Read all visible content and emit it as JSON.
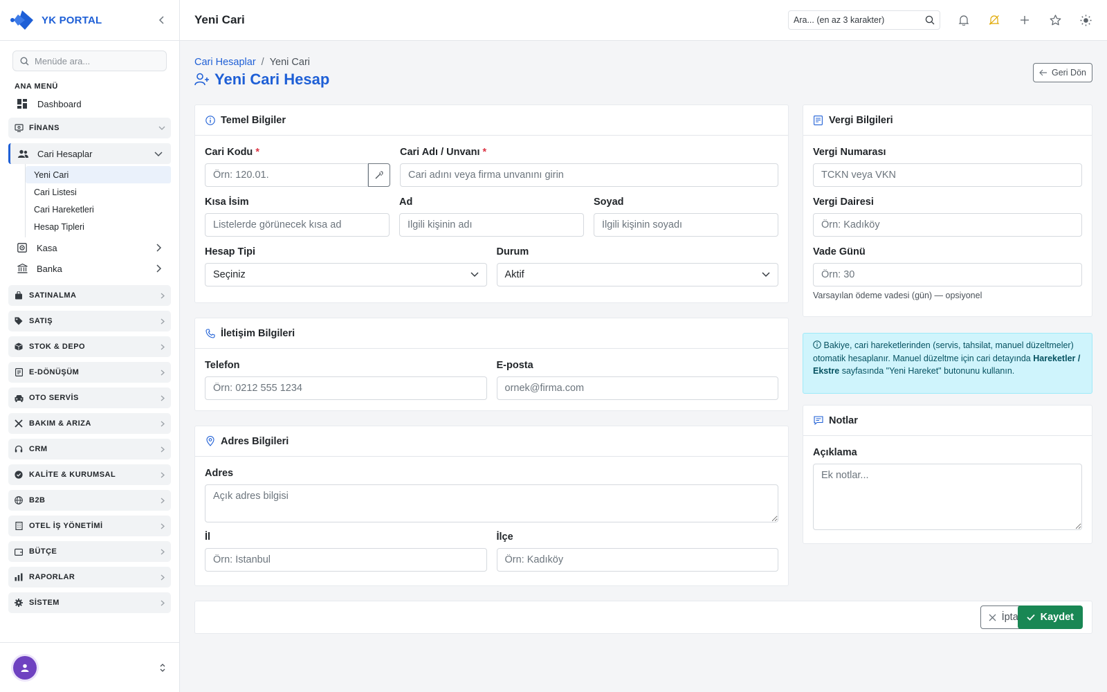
{
  "brand": {
    "name": "YK PORTAL"
  },
  "sidebar": {
    "search_placeholder": "Menüde ara...",
    "section_title": "ANA MENÜ",
    "dashboard_label": "Dashboard",
    "finans_label": "FİNANS",
    "cari_label": "Cari Hesaplar",
    "cari_sub": [
      "Yeni Cari",
      "Cari Listesi",
      "Cari Hareketleri",
      "Hesap Tipleri"
    ],
    "kasa_label": "Kasa",
    "banka_label": "Banka",
    "groups": [
      "SATINALMA",
      "SATIŞ",
      "STOK & DEPO",
      "E-DÖNÜŞÜM",
      "OTO SERVİS",
      "BAKIM & ARIZA",
      "CRM",
      "KALİTE & KURUMSAL",
      "B2B",
      "OTEL İŞ YÖNETİMİ",
      "BÜTÇE",
      "RAPORLAR",
      "SİSTEM"
    ]
  },
  "topbar": {
    "title": "Yeni Cari",
    "search_placeholder": "Ara... (en az 3 karakter)"
  },
  "breadcrumb": {
    "parent": "Cari Hesaplar",
    "separator": "/",
    "current": "Yeni Cari"
  },
  "page": {
    "title": "Yeni Cari Hesap",
    "back_label": "Geri Dön"
  },
  "temel": {
    "title": "Temel Bilgiler",
    "cari_kodu_label": "Cari Kodu",
    "cari_kodu_placeholder": "Örn: 120.01.",
    "cari_adi_label": "Cari Adı / Unvanı",
    "cari_adi_placeholder": "Cari adını veya firma unvanını girin",
    "kisa_isim_label": "Kısa İsim",
    "kisa_isim_placeholder": "Listelerde görünecek kısa ad",
    "ad_label": "Ad",
    "ad_placeholder": "İlgili kişinin adı",
    "soyad_label": "Soyad",
    "soyad_placeholder": "İlgili kişinin soyadı",
    "hesap_tipi_label": "Hesap Tipi",
    "hesap_tipi_value": "Seçiniz",
    "durum_label": "Durum",
    "durum_value": "Aktif",
    "required_mark": "*"
  },
  "iletisim": {
    "title": "İletişim Bilgileri",
    "telefon_label": "Telefon",
    "telefon_placeholder": "Örn: 0212 555 1234",
    "eposta_label": "E-posta",
    "eposta_placeholder": "ornek@firma.com"
  },
  "adres": {
    "title": "Adres Bilgileri",
    "adres_label": "Adres",
    "adres_placeholder": "Açık adres bilgisi",
    "il_label": "İl",
    "il_placeholder": "Örn: İstanbul",
    "ilce_label": "İlçe",
    "ilce_placeholder": "Örn: Kadıköy"
  },
  "vergi": {
    "title": "Vergi Bilgileri",
    "no_label": "Vergi Numarası",
    "no_placeholder": "TCKN veya VKN",
    "daire_label": "Vergi Dairesi",
    "daire_placeholder": "Örn: Kadıköy",
    "vade_label": "Vade Günü",
    "vade_placeholder": "Örn: 30",
    "vade_help": "Varsayılan ödeme vadesi (gün) — opsiyonel"
  },
  "info": {
    "text_1": "Bakiye, cari hareketlerinden (servis, tahsilat, manuel düzeltmeler) otomatik hesaplanır. Manuel düzeltme için cari detayında ",
    "bold": "Hareketler / Ekstre",
    "text_2": " sayfasında \"Yeni Hareket\" butonunu kullanın."
  },
  "notlar": {
    "title": "Notlar",
    "aciklama_label": "Açıklama",
    "aciklama_placeholder": "Ek notlar..."
  },
  "actions": {
    "cancel_label": "İptal",
    "save_label": "Kaydet"
  },
  "colors": {
    "primary": "#1e5fd6",
    "success": "#198754",
    "info_bg": "#cff4fc",
    "required": "#dc3545",
    "avatar": "#6f42c1"
  }
}
